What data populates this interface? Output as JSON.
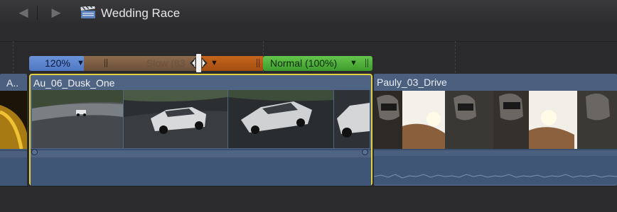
{
  "toolbar": {
    "back_icon": "chevron-left-icon",
    "forward_icon": "chevron-right-icon",
    "project_icon": "clapperboard-icon",
    "project_title": "Wedding Race"
  },
  "retime": {
    "fast_label": "120%",
    "slow_label": "Slow (83",
    "normal_label": "Normal (100%)",
    "colors": {
      "fast": "#5b84cc",
      "slow": "#7a5c42",
      "ramp": "#b35a17",
      "normal": "#4fb23a"
    }
  },
  "timeline": {
    "clips": [
      {
        "name": "A.."
      },
      {
        "name": "Au_06_Dusk_One"
      },
      {
        "name": "Pauly_03_Drive"
      }
    ],
    "selection_color": "#e2d243"
  }
}
